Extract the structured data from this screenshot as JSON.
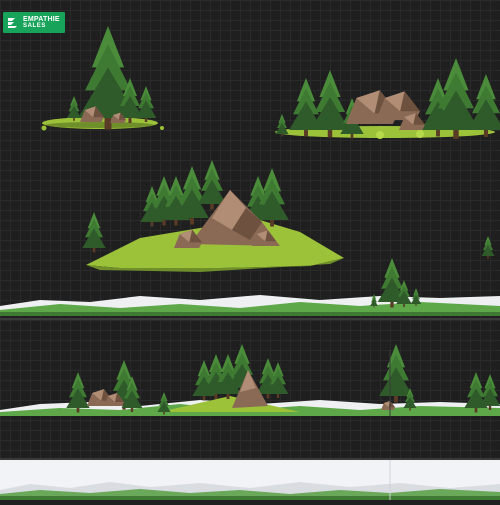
{
  "logo": {
    "line1": "EMPATHIE",
    "line2": "SALES",
    "brand_color": "#18a35a",
    "icon": "chevron-stack-icon"
  },
  "colors": {
    "background": "#1f1f1f",
    "grid": "#2a2a2a",
    "pine_dark": "#2f5a2a",
    "pine_light": "#4a8c3a",
    "grass": "#9cc23a",
    "rock": "#8a6a55",
    "snow": "#eef0f2",
    "bottom_strip": "#f1f3f6"
  }
}
